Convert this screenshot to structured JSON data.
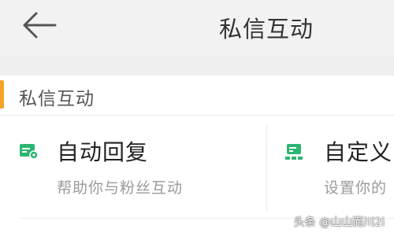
{
  "header": {
    "title": "私信互动",
    "back_icon": "back-arrow-icon"
  },
  "section": {
    "title": "私信互动",
    "accent_color": "#f5a326"
  },
  "cards": [
    {
      "title": "自动回复",
      "description": "帮助你与粉丝互动",
      "icon": "auto-reply-icon",
      "icon_color": "#2bb673"
    },
    {
      "title": "自定义",
      "description": "设置你的",
      "icon": "custom-menu-icon",
      "icon_color": "#2bb673"
    }
  ],
  "watermark": "头条 @山山而川2i"
}
